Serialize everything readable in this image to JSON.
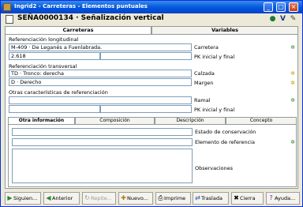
{
  "window": {
    "title": "Ingrid2 - Carreteras - Elementos puntuales",
    "minimize": "_",
    "maximize": "□",
    "close": "×"
  },
  "header": {
    "title": "SEÑA0000134 · Señalización vertical"
  },
  "tabs": [
    {
      "label": "Carreteras"
    },
    {
      "label": "Variables"
    }
  ],
  "ref_longitudinal": {
    "label": "Referenciación longitudinal",
    "carretera_value": "M-409 · De Leganés a Fuenlabrada.",
    "carretera_label": "Carretera",
    "pk_value": "2.618",
    "pk_value2": "",
    "pk_label": "PK inicial y final"
  },
  "ref_transversal": {
    "label": "Referenciación transversal",
    "calzada_value": "TD · Tronco: derecha",
    "calzada_label": "Calzada",
    "margen_value": "D · Derecho",
    "margen_label": "Margen"
  },
  "otras": {
    "label": "Otras características de referenciación",
    "ramal_value": "",
    "ramal_label": "Ramal",
    "pk_value": "",
    "pk_value2": "",
    "pk_label": "PK inicial y final"
  },
  "subtabs": [
    {
      "label": "Otra información"
    },
    {
      "label": "Composición"
    },
    {
      "label": "Descripción"
    },
    {
      "label": "Concepto"
    }
  ],
  "otra_info": {
    "estado_label": "Estado de conservación",
    "estado_value": "",
    "elemento_label": "Elemento de referencia",
    "elemento_value": "",
    "observaciones_label": "Observaciones",
    "observaciones_value": ""
  },
  "toolbar": [
    {
      "label": "Siguien...",
      "icon": "▶"
    },
    {
      "label": "Anterior",
      "icon": "◀"
    },
    {
      "label": "Repite...",
      "icon": "↻"
    },
    {
      "label": "Nuevo...",
      "icon": "✚"
    },
    {
      "label": "Imprime",
      "icon": "⎙"
    },
    {
      "label": "Traslada",
      "icon": "⇄"
    },
    {
      "label": "Cierra",
      "icon": "✖"
    },
    {
      "label": "Ayuda...",
      "icon": "?"
    }
  ]
}
